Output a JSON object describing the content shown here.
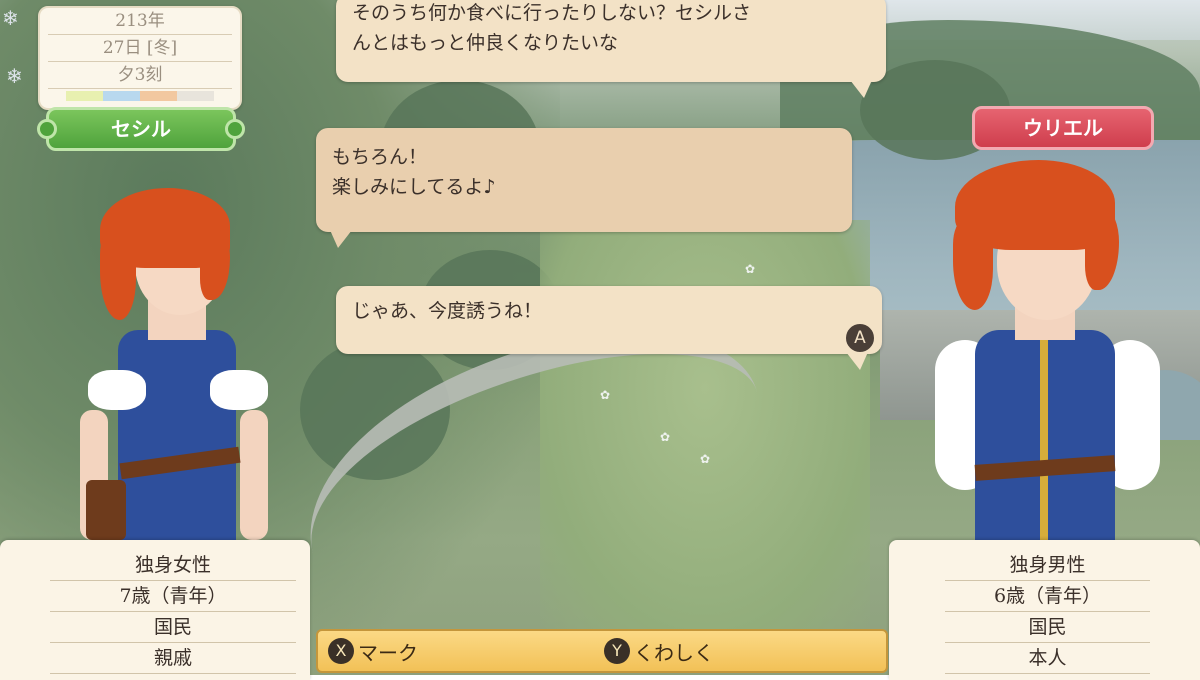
{
  "date": {
    "year": "213年",
    "day": "27日 [冬]",
    "time": "夕3刻",
    "season_colors": [
      "#e8f0b0",
      "#b8d8ee",
      "#f2c8a0",
      "#e8e4dc"
    ]
  },
  "characters": {
    "left_name": "セシル",
    "right_name": "ウリエル"
  },
  "dialogue": {
    "line1_a": "そのうち何か食べに行ったりしない？セシルさ",
    "line1_b": "んとはもっと仲良くなりたいな",
    "line2_a": "もちろん！",
    "line2_b": "楽しみにしてるよ♪",
    "line3": "じゃあ、今度誘うね！",
    "advance_button": "A"
  },
  "left_info": [
    "独身女性",
    "7歳（青年）",
    "国民",
    "親戚"
  ],
  "right_info": [
    "独身男性",
    "6歳（青年）",
    "国民",
    "本人"
  ],
  "controls": {
    "mark_button": "X",
    "mark_label": "マーク",
    "detail_button": "Y",
    "detail_label": "くわしく"
  }
}
